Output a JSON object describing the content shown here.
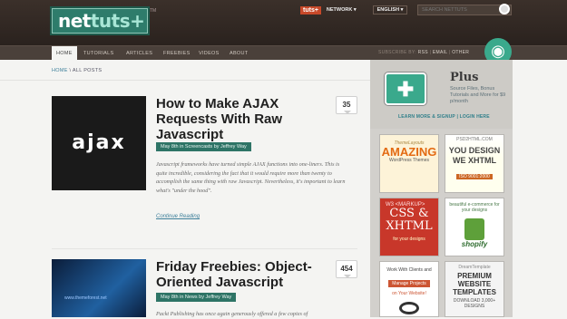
{
  "header": {
    "logo_main": "net",
    "logo_accent": "tuts+",
    "trademark": "TM",
    "brand": "tuts+",
    "network": "NETWORK ▾",
    "language": "ENGLISH ▾",
    "search_placeholder": "SEARCH NETTUTS"
  },
  "nav": {
    "items": [
      "HOME",
      "TUTORIALS",
      "ARTICLES",
      "FREEBIES",
      "VIDEOS",
      "ABOUT"
    ],
    "active": "HOME"
  },
  "subscribe": {
    "label": "SUBSCRIBE BY:",
    "options": [
      "RSS",
      "EMAIL",
      "OTHER"
    ],
    "separator": "|"
  },
  "breadcrumb": {
    "home": "HOME",
    "sep": "\\",
    "current": "ALL POSTS"
  },
  "posts": [
    {
      "thumb_text": "ajax",
      "title": "How to Make AJAX Requests With Raw Javascript",
      "meta": "May 8th in Screencasts by Jeffrey Way",
      "excerpt": "Javascript frameworks have turned simple AJAX functions into one-liners. This is quite incredible, considering the fact that it would require more than twenty to accomplish the same thing with raw Javascript. Nevertheless, it's important to learn what's \"under the hood\".",
      "more": "Continue Reading",
      "comments": "35"
    },
    {
      "thumb_text": "www.themeforest.net",
      "title": "Friday Freebies: Object-Oriented Javascript",
      "meta": "May 8th in News by Jeffrey Way",
      "excerpt": "Packt Publishing has once again generously offered a few copies of",
      "comments": "454"
    }
  ],
  "plus": {
    "title": "Plus",
    "desc": "Source Files, Bonus Tutorials and More for $9 p/month",
    "links": "LEARN MORE & SIGNUP  |  LOGIN HERE"
  },
  "ads": [
    {
      "s": "ThemeLayouts",
      "b": "AMAZING",
      "c": "WordPress Themes"
    },
    {
      "s": "PSD2HTML.COM",
      "b": "YOU DESIGN WE XHTML",
      "c": "ISO 9001:2000"
    },
    {
      "s": "W3 <MARKUP>",
      "b": "CSS & XHTML",
      "c": "for your designs"
    },
    {
      "s": "beautiful e-commerce for your designs",
      "c": "shopify"
    },
    {
      "s": "Work With Clients and",
      "b": "Manage Projects",
      "c": "on Your Website!"
    },
    {
      "s": "DreamTemplate",
      "b": "PREMIUM WEBSITE TEMPLATES",
      "c": "DOWNLOAD 3,000+ DESIGNS"
    }
  ],
  "colors": {
    "brand": "#2e7c6b",
    "accent": "#3aa98c",
    "header_bg": "#2e2520",
    "orange": "#c8492a"
  }
}
